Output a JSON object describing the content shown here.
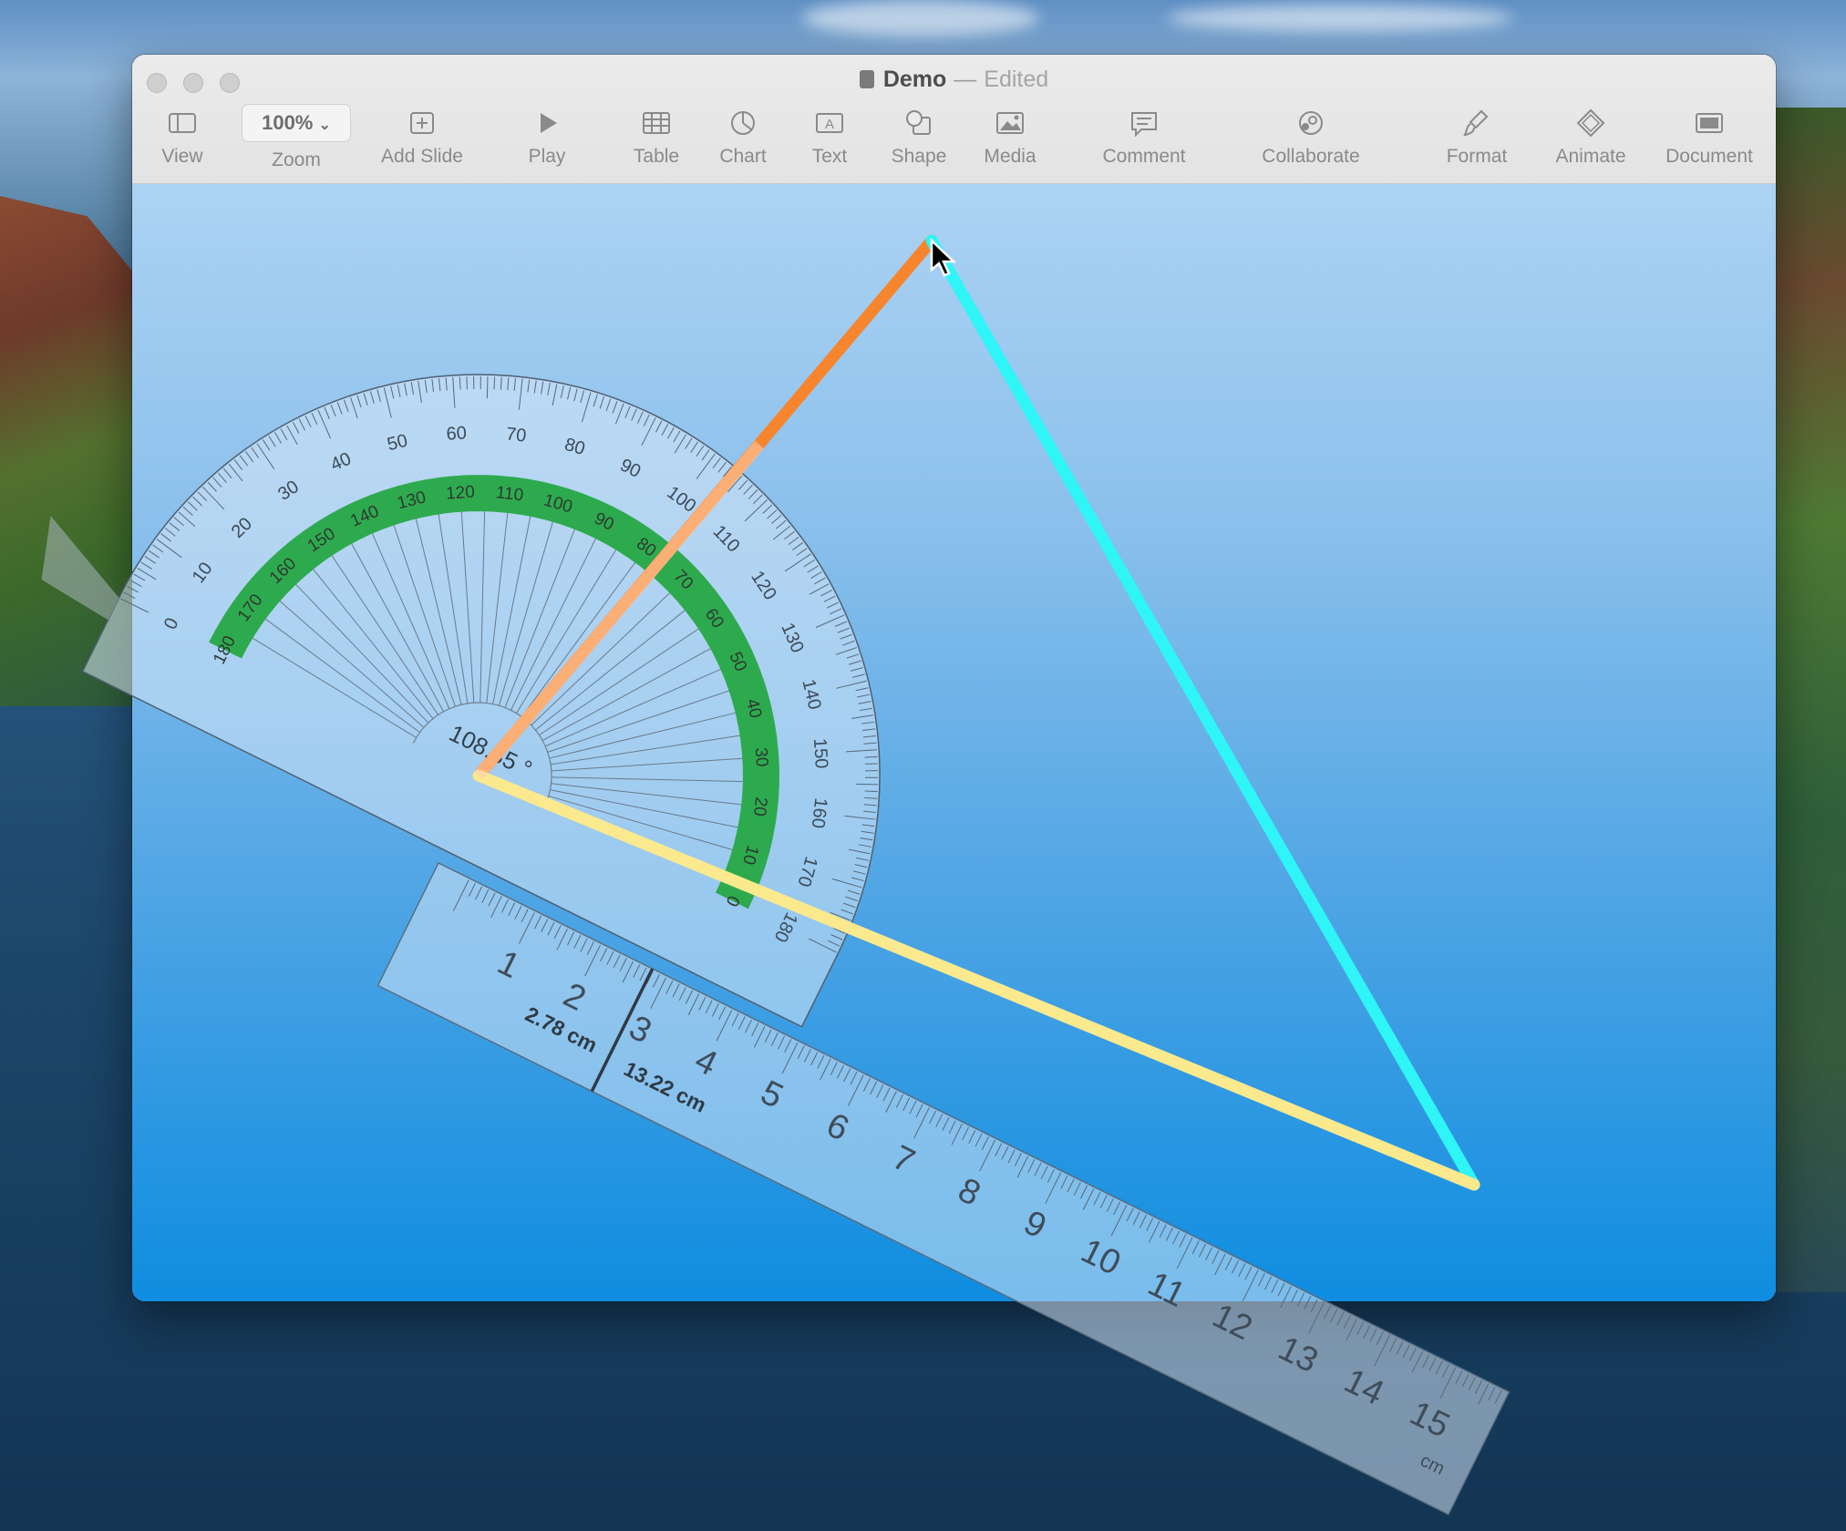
{
  "window": {
    "title": "Demo",
    "separator": "—",
    "status": "Edited"
  },
  "toolbar": {
    "view": "View",
    "zoom_value": "100%",
    "zoom": "Zoom",
    "add_slide": "Add Slide",
    "play": "Play",
    "table": "Table",
    "chart": "Chart",
    "text": "Text",
    "shape": "Shape",
    "media": "Media",
    "comment": "Comment",
    "collaborate": "Collaborate",
    "format": "Format",
    "animate": "Animate",
    "document": "Document"
  },
  "protractor": {
    "angle_readout": "108.35 °",
    "outer_scale": [
      "0",
      "10",
      "20",
      "30",
      "40",
      "50",
      "60",
      "70",
      "80",
      "90",
      "100",
      "110",
      "120",
      "130",
      "140",
      "150",
      "160",
      "170",
      "180"
    ],
    "inner_scale": [
      "180",
      "170",
      "160",
      "150",
      "140",
      "130",
      "120",
      "110",
      "100",
      "90",
      "80",
      "70",
      "60",
      "50",
      "40",
      "30",
      "20",
      "10",
      "0"
    ]
  },
  "ruler": {
    "numbers": [
      "1",
      "2",
      "3",
      "4",
      "5",
      "6",
      "7",
      "8",
      "9",
      "10",
      "11",
      "12",
      "13",
      "14",
      "15"
    ],
    "unit": "cm",
    "marker_left_label": "2.78 cm",
    "marker_right_label": "13.22 cm"
  },
  "colors": {
    "orange_line": "#f7852e",
    "cyan_line": "#2ff5f7",
    "yellow_line": "#fbe98e",
    "green_band": "#27a844"
  }
}
